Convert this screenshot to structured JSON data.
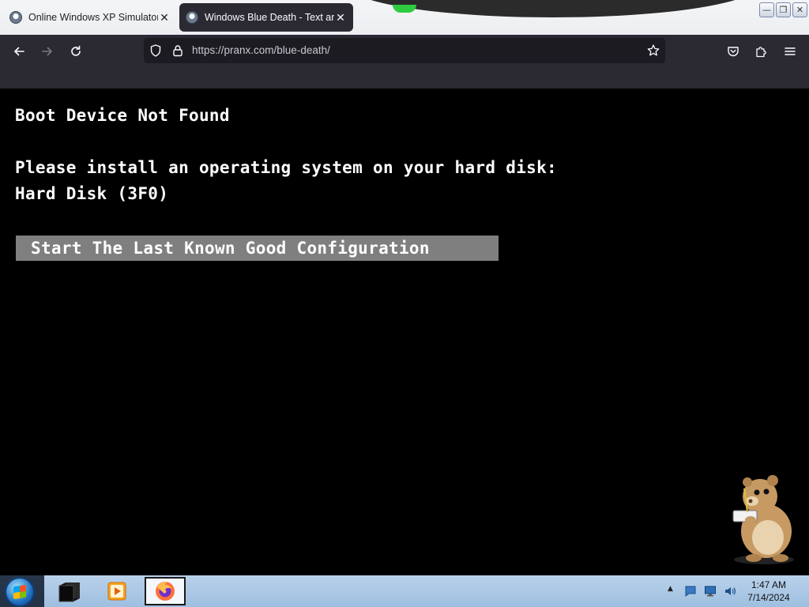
{
  "browser": {
    "tabs": [
      {
        "title": "Online Windows XP Simulator |",
        "active": false
      },
      {
        "title": "Windows Blue Death - Text and",
        "active": true
      }
    ],
    "url": "https://pranx.com/blue-death/",
    "icons": {
      "back": "arrow-left-icon",
      "forward": "arrow-right-icon",
      "reload": "reload-icon",
      "tracking": "shield-icon",
      "lock": "lock-icon",
      "bookmark": "star-icon",
      "pocket": "pocket-icon",
      "extensions": "puzzle-icon",
      "menu": "hamburger-menu-icon"
    }
  },
  "window_controls": {
    "minimize": "—",
    "restore": "❐",
    "close": "✕"
  },
  "screen": {
    "line1": "Boot Device Not Found",
    "line2": "Please install an operating system on your hard disk:",
    "line3": "Hard Disk (3F0)",
    "button_label": "Start The Last Known Good Configuration",
    "colors": {
      "background": "#000000",
      "text": "#ffffff",
      "button": "#7f7f7f"
    }
  },
  "taskbar": {
    "pinned": [
      "terminal-icon",
      "media-player-icon",
      "firefox-icon"
    ],
    "clock_time": "1:47 AM",
    "clock_date": "7/14/2024"
  }
}
